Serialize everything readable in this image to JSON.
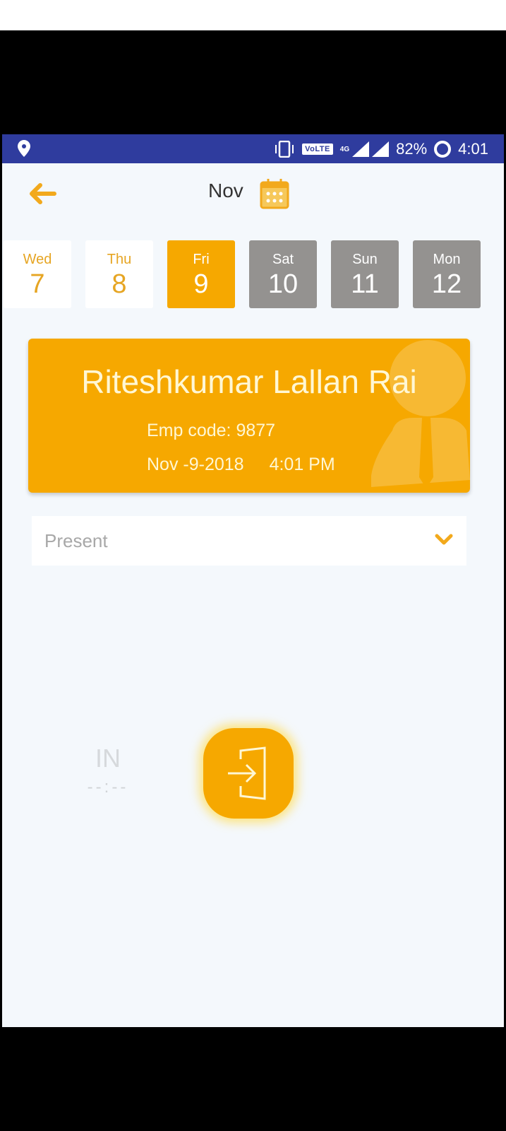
{
  "status_bar": {
    "network_badge": "VoLTE",
    "network_type": "4G",
    "battery": "82%",
    "time": "4:01",
    "icons": [
      "location-icon",
      "vibrate-icon",
      "volte-icon",
      "signal-icon",
      "battery-ring-icon"
    ]
  },
  "header": {
    "back_icon": "arrow-left-icon",
    "month": "Nov",
    "calendar_icon": "calendar-icon"
  },
  "days": [
    {
      "name": "Wed",
      "date": "7",
      "state": "past"
    },
    {
      "name": "Thu",
      "date": "8",
      "state": "past"
    },
    {
      "name": "Fri",
      "date": "9",
      "state": "selected"
    },
    {
      "name": "Sat",
      "date": "10",
      "state": "future"
    },
    {
      "name": "Sun",
      "date": "11",
      "state": "future"
    },
    {
      "name": "Mon",
      "date": "12",
      "state": "future"
    }
  ],
  "employee": {
    "name": "Riteshkumar Lallan Rai",
    "emp_code": "Emp code: 9877",
    "date": "Nov -9-2018",
    "time": "4:01 PM"
  },
  "attendance_status": {
    "selected": "Present"
  },
  "punch": {
    "in_label": "IN",
    "in_time": "--:--",
    "button_icon": "login-icon"
  },
  "colors": {
    "accent": "#f6a800",
    "status_bar": "#2f3c9e",
    "future_day": "#949290",
    "background": "#f4f8fc"
  }
}
